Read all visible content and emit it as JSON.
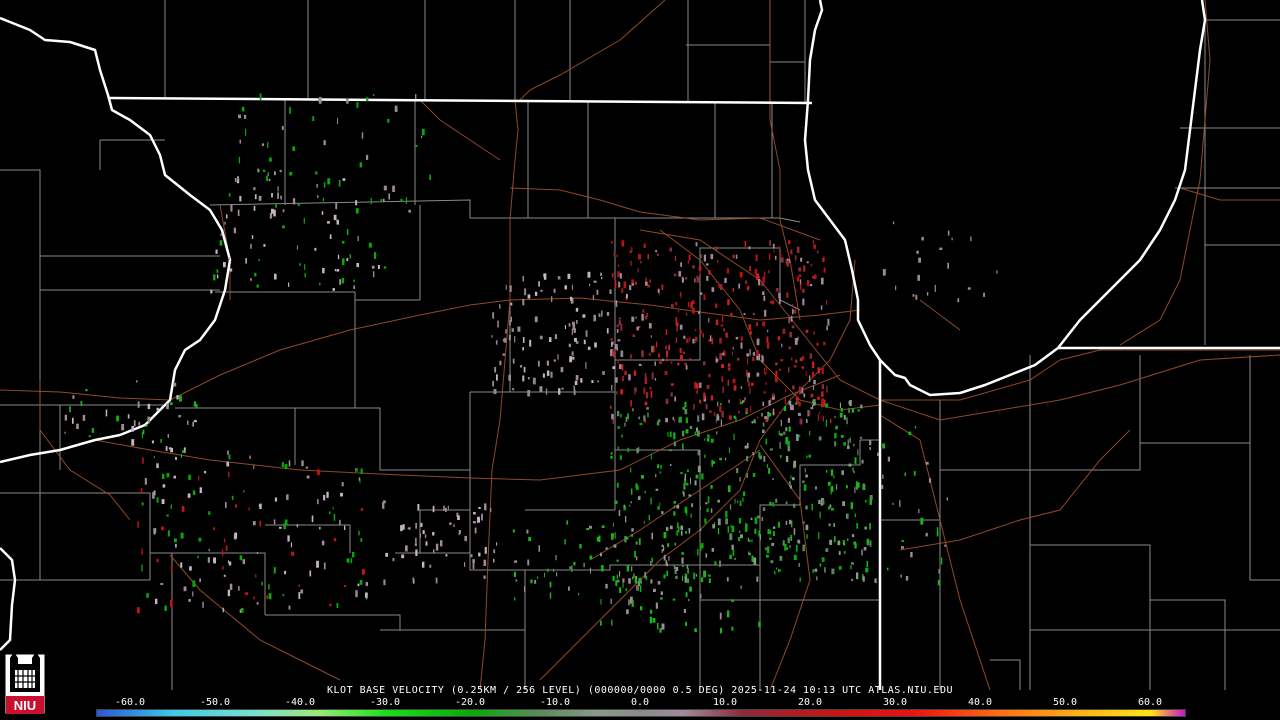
{
  "product": {
    "caption": "KLOT BASE VELOCITY (0.25KM / 256 LEVEL) (000000/0000 0.5 DEG) 2025-11-24 10:13 UTC  ATLAS.NIU.EDU"
  },
  "logo": {
    "text": "NIU",
    "color": "#c8102e"
  },
  "colors": {
    "background": "#000000",
    "state_border": "#ffffff",
    "county_border": "#8a8a8a",
    "highway": "#a0522d"
  },
  "legend": {
    "ticks": [
      {
        "value": -60,
        "label": "-60.0"
      },
      {
        "value": -50,
        "label": "-50.0"
      },
      {
        "value": -40,
        "label": "-40.0"
      },
      {
        "value": -30,
        "label": "-30.0"
      },
      {
        "value": -20,
        "label": "-20.0"
      },
      {
        "value": -10,
        "label": "-10.0"
      },
      {
        "value": 0,
        "label": "0.0"
      },
      {
        "value": 10,
        "label": "10.0"
      },
      {
        "value": 20,
        "label": "20.0"
      },
      {
        "value": 30,
        "label": "30.0"
      },
      {
        "value": 40,
        "label": "40.0"
      },
      {
        "value": 50,
        "label": "50.0"
      },
      {
        "value": 60,
        "label": "60.0"
      }
    ],
    "range": [
      -64,
      64
    ],
    "stops": [
      {
        "value": -64,
        "color": "#2b57d9"
      },
      {
        "value": -55,
        "color": "#3fc8e6"
      },
      {
        "value": -45,
        "color": "#7ee0c8"
      },
      {
        "value": -38,
        "color": "#9be87a"
      },
      {
        "value": -30,
        "color": "#19e019"
      },
      {
        "value": -20,
        "color": "#0aa80a"
      },
      {
        "value": -12,
        "color": "#5a8a5a"
      },
      {
        "value": -5,
        "color": "#8a9a8a"
      },
      {
        "value": 0,
        "color": "#8a8a8a"
      },
      {
        "value": 5,
        "color": "#a08a9a"
      },
      {
        "value": 12,
        "color": "#8a2a3a"
      },
      {
        "value": 22,
        "color": "#c81414"
      },
      {
        "value": 32,
        "color": "#f01010"
      },
      {
        "value": 42,
        "color": "#ff6a14"
      },
      {
        "value": 52,
        "color": "#ffb414"
      },
      {
        "value": 60,
        "color": "#ffe614"
      },
      {
        "value": 64,
        "color": "#c814c8"
      }
    ]
  }
}
